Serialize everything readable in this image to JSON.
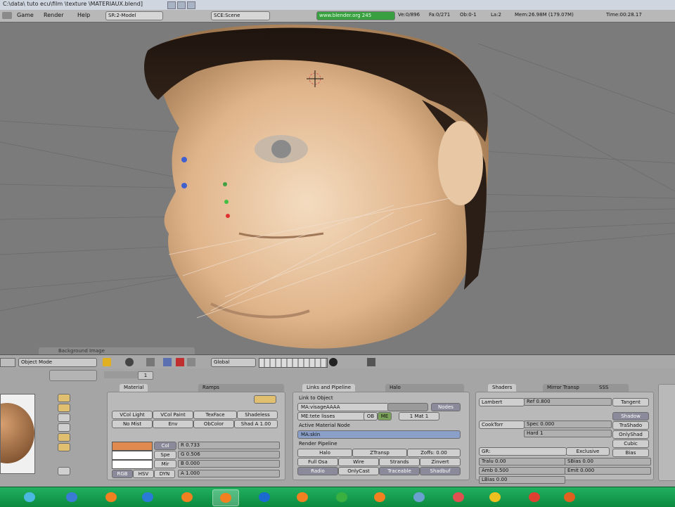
{
  "window": {
    "title": "C:\\data\\ tuto ecu\\film \\texture \\MATERIAUX.blend]"
  },
  "header": {
    "menus": [
      "Game",
      "Render",
      "Help"
    ],
    "screen": "SR:2-Model",
    "scene": "SCE:Scene",
    "url": "www.blender.org 245",
    "stats": [
      "Ve:0/896",
      "Fa:0/271",
      "Ob:0-1",
      "La:2",
      "Mem:26.98M (179.07M)",
      "Time:00:28.17"
    ]
  },
  "viewport": {
    "menu_label": "Background Image"
  },
  "view_header": {
    "mode": "Object Mode",
    "orientation": "Global",
    "layer_value": "1"
  },
  "material_panel": {
    "tab_active": "Material",
    "tab_inactive": "Ramps",
    "row1": [
      "VCol Light",
      "VCol Paint",
      "TexFace",
      "Shadeless"
    ],
    "row2": [
      "No Mist",
      "Env",
      "ObColor",
      "Shad A 1.00"
    ],
    "col_btn": "Col",
    "spe_btn": "Spe",
    "mir_btn": "Mir",
    "r_value": "R 0.733",
    "g_value": "G 0.506",
    "b_value": "B 0.000",
    "a_value": "A 1.000",
    "modes": [
      "RGB",
      "HSV",
      "DYN"
    ],
    "colors": {
      "col": "#e08a50",
      "spe": "#ffffff",
      "mir": "#ffffff"
    }
  },
  "links_panel": {
    "tab_active": "Links and Pipeline",
    "tab_inactive": "Halo",
    "link_to_object": "Link to Object",
    "material_name": "MA:visageAAAA",
    "nodes_btn": "Nodes",
    "me_label": "ME:tete lisses",
    "ob_btn": "OB",
    "me_btn": "ME",
    "mat_count": "1 Mat 1",
    "active_node": "Active Material Node",
    "node_name": "MA:skin",
    "render_pipeline": "Render Pipeline",
    "pipeline_row1": [
      "Halo",
      "ZTransp",
      "Zoffs: 0.00"
    ],
    "pipeline_row2": [
      "Full Osa",
      "Wire",
      "Strands",
      "Zinvert"
    ],
    "pipeline_row3": [
      "Radio",
      "OnlyCast",
      "Traceable",
      "Shadbuf"
    ]
  },
  "shaders_panel": {
    "tab_active": "Shaders",
    "tab_2": "Mirror Transp",
    "tab_3": "SSS",
    "diffuse": "Lambert",
    "ref": "Ref 0.800",
    "tangent_btn": "Tangent",
    "spec_shader": "CookTorr",
    "spec": "Spec 0.000",
    "hard": "Hard 1",
    "right_buttons": [
      "Shadow",
      "TraShado",
      "OnlyShad",
      "Cubic",
      "Bias"
    ],
    "gr": "GR:",
    "exclusive": "Exclusive",
    "tralu": "Tralu 0.00",
    "sbias": "SBias 0.00",
    "amb": "Amb 0.500",
    "emit": "Emit 0.000",
    "lbias": "LBias 0.00"
  },
  "taskbar": {
    "apps": [
      "start-icon",
      "hammer-icon",
      "blender-icon",
      "ie-icon",
      "blender-icon",
      "blender-icon",
      "photoshop-icon",
      "blender-icon",
      "utorrent-icon",
      "blender-icon",
      "picture-icon",
      "media-icon",
      "windows-icon",
      "chrome-icon",
      "firefox-icon"
    ],
    "colors": [
      "#4ab8e0",
      "#3a7bd5",
      "#f08020",
      "#2a7ad8",
      "#f08020",
      "#f08020",
      "#1a6ad0",
      "#f08020",
      "#3ab040",
      "#f08020",
      "#6aa0d0",
      "#e05050",
      "#f0c020",
      "#e04030",
      "#e06020"
    ]
  }
}
